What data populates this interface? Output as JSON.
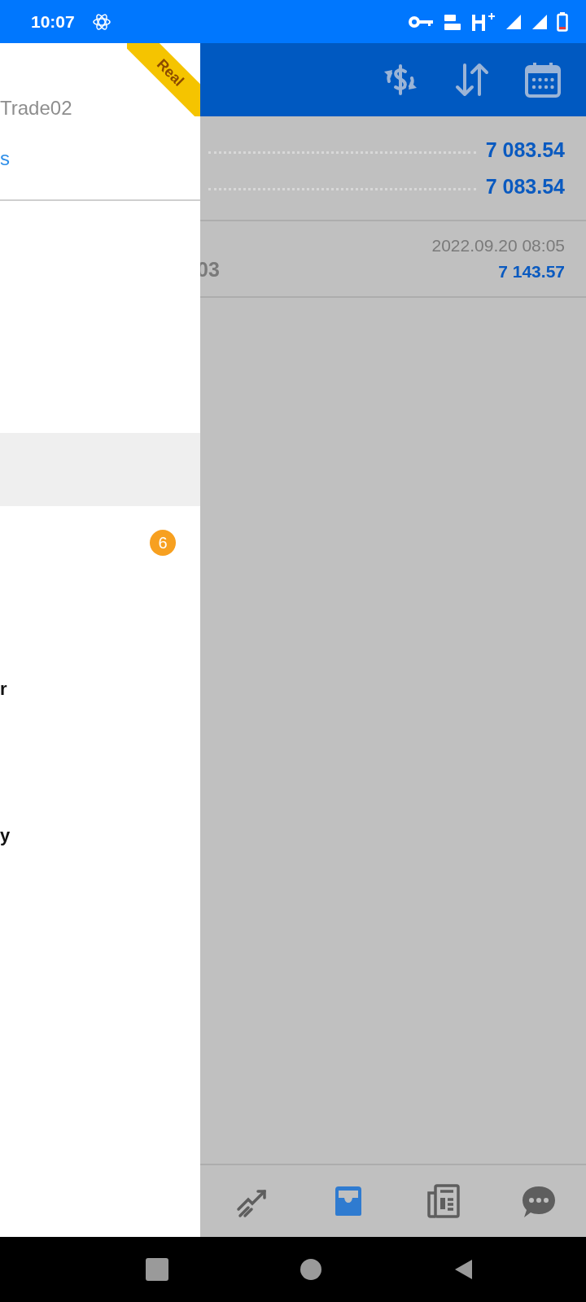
{
  "status_bar": {
    "time": "10:07"
  },
  "drawer": {
    "ribbon": "Real",
    "account_name": "Trade02",
    "link": "s",
    "items": [
      {
        "selected": true
      },
      {
        "badge": "6",
        "selected": false
      },
      {
        "label": "r",
        "selected": false
      },
      {
        "label": "y",
        "selected": false
      }
    ]
  },
  "balances": [
    {
      "value": "7 083.54"
    },
    {
      "value": "7 083.54"
    }
  ],
  "trade": {
    "symbol": "03",
    "time": "2022.09.20 08:05",
    "value": "7 143.57"
  },
  "bottom_nav": [
    {
      "kind": "trade",
      "selected": false
    },
    {
      "kind": "history",
      "selected": true
    },
    {
      "kind": "news",
      "selected": false
    },
    {
      "kind": "chat",
      "selected": false
    }
  ]
}
